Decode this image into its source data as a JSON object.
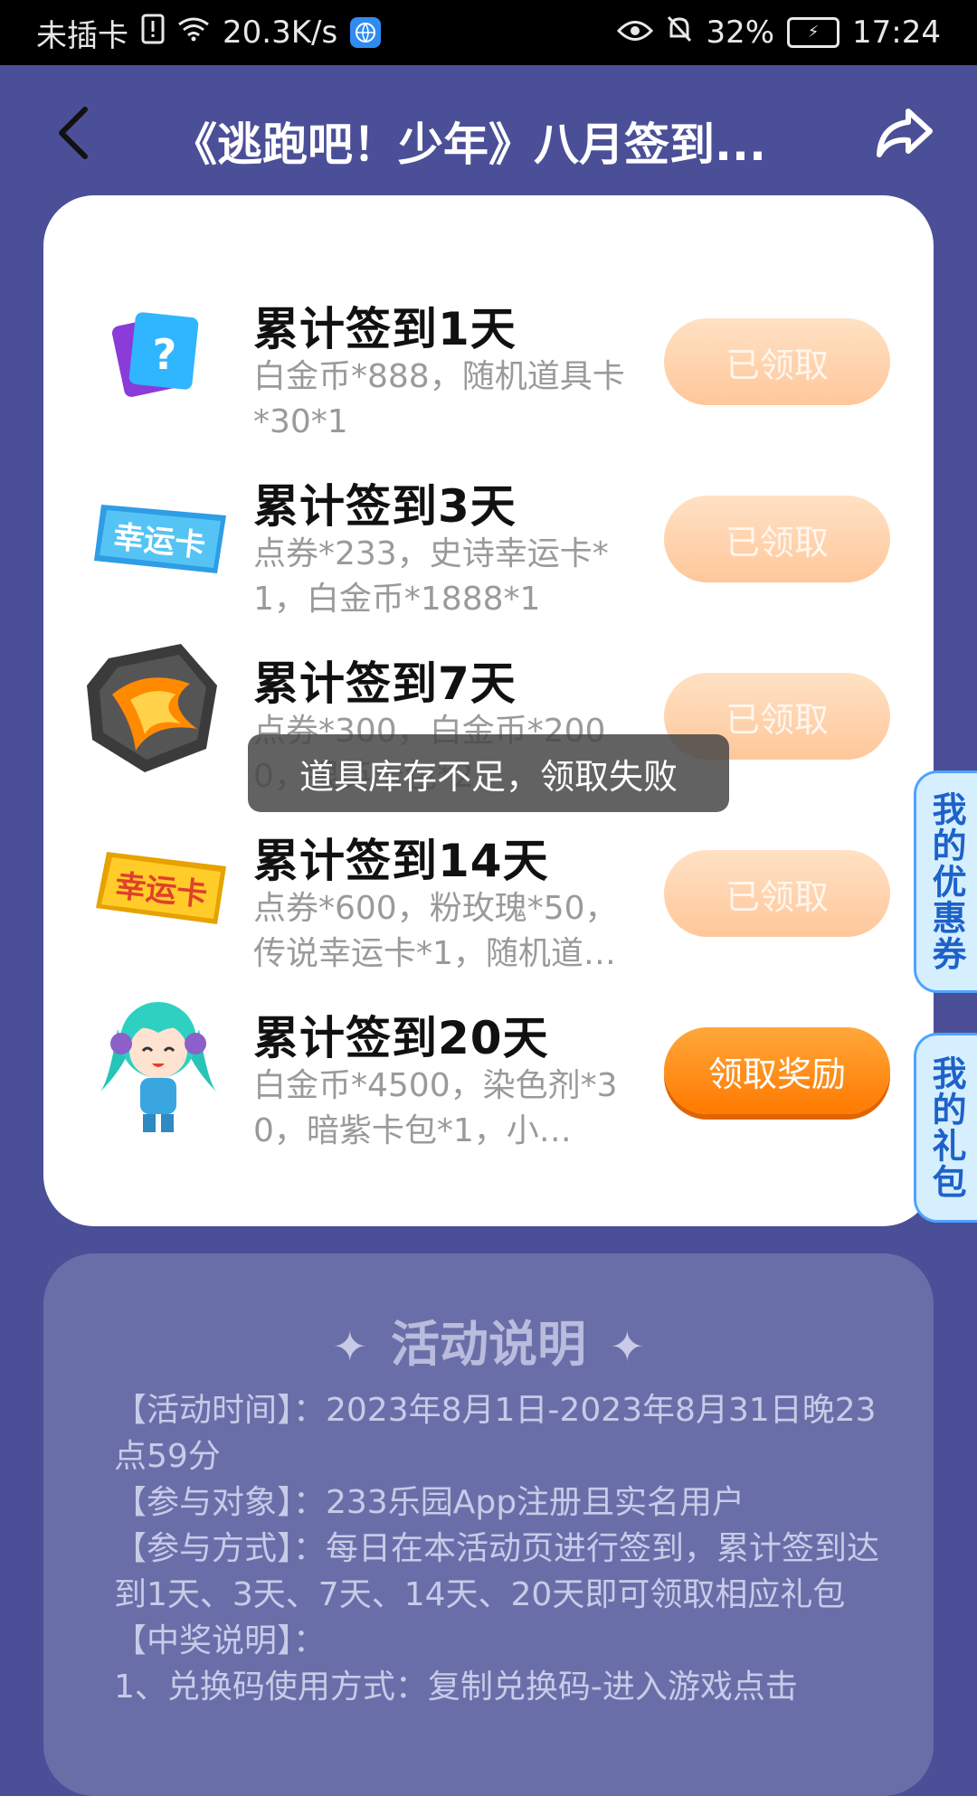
{
  "status_bar": {
    "carrier": "未插卡",
    "speed": "20.3K/s",
    "battery": "32%",
    "time": "17:24"
  },
  "app_bar": {
    "title": "《逃跑吧！少年》八月签到..."
  },
  "rewards": [
    {
      "title": "累计签到1天",
      "desc": "白金币*888，随机道具卡*30*1",
      "button": "已领取",
      "state": "claimed",
      "icon": "question-card-icon"
    },
    {
      "title": "累计签到3天",
      "desc": "点券*233，史诗幸运卡*1，白金币*1888*1",
      "button": "已领取",
      "state": "claimed",
      "icon": "blue-lucky-card-icon"
    },
    {
      "title": "累计签到7天",
      "desc": "点券*300，白金币*2000，银英卡包*2",
      "button": "已领取",
      "state": "claimed",
      "icon": "lava-rock-icon"
    },
    {
      "title": "累计签到14天",
      "desc": "点券*600，粉玫瑰*50，传说幸运卡*1，随机道…",
      "button": "已领取",
      "state": "claimed",
      "icon": "gold-lucky-card-icon"
    },
    {
      "title": "累计签到20天",
      "desc": "白金币*4500，染色剂*30，暗紫卡包*1，小…",
      "button": "领取奖励",
      "state": "available",
      "icon": "character-avatar-icon"
    }
  ],
  "side_tabs": {
    "coupons": "我的优惠券",
    "gifts": "我的礼包"
  },
  "toast": "道具库存不足，领取失败",
  "info": {
    "heading": "活动说明",
    "lines": [
      "【活动时间】：2023年8月1日-2023年8月31日晚23点59分",
      "【参与对象】：233乐园App注册且实名用户",
      "【参与方式】：每日在本活动页进行签到，累计签到达到1天、3天、7天、14天、20天即可领取相应礼包",
      "【中奖说明】：",
      "1、兑换码使用方式：复制兑换码-进入游戏点击"
    ]
  },
  "colors": {
    "background": "#4b4f97",
    "claimed_button": "#ffd2ad",
    "active_button": "#ff8a10",
    "side_tab": "#d6efff"
  }
}
